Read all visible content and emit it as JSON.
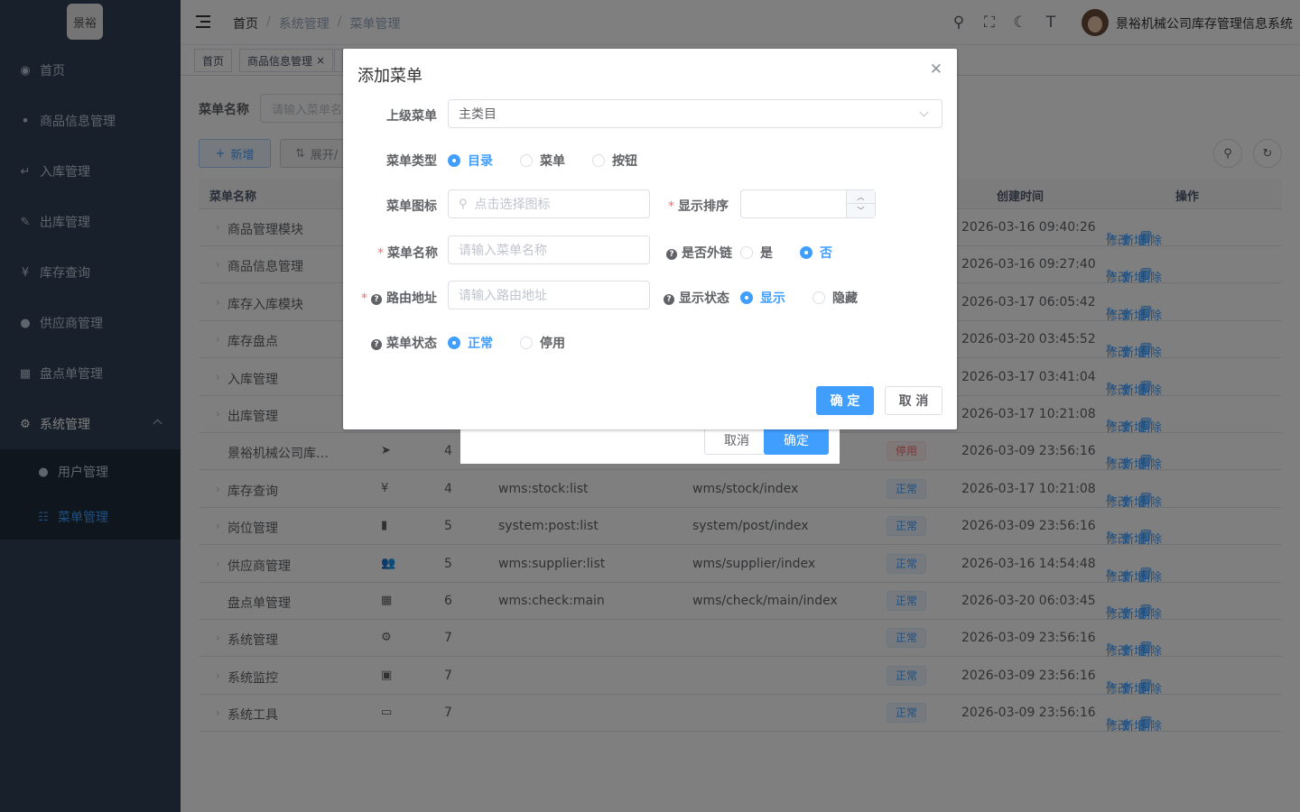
{
  "logo": {
    "text": "景裕"
  },
  "sidebar": {
    "items": [
      {
        "label": "首页",
        "icon": "dashboard-icon"
      },
      {
        "label": "商品信息管理",
        "icon": "tree-icon"
      },
      {
        "label": "入库管理",
        "icon": "enter-icon"
      },
      {
        "label": "出库管理",
        "icon": "edit-doc-icon"
      },
      {
        "label": "库存查询",
        "icon": "yen-icon"
      },
      {
        "label": "供应商管理",
        "icon": "peoples-icon"
      },
      {
        "label": "盘点单管理",
        "icon": "table-icon"
      },
      {
        "label": "系统管理",
        "icon": "gear-icon"
      }
    ],
    "sub_items": [
      {
        "label": "用户管理",
        "icon": "user-icon"
      },
      {
        "label": "菜单管理",
        "icon": "tree-table-icon"
      }
    ]
  },
  "navbar": {
    "breadcrumb": [
      "首页",
      "系统管理",
      "菜单管理"
    ],
    "system_name": "景裕机械公司库存管理信息系统"
  },
  "tags": [
    "首页",
    "商品信息管理"
  ],
  "query": {
    "label": "菜单名称",
    "placeholder": "请输入菜单名"
  },
  "toolbar": {
    "add_label": "新增",
    "expand_label": "展开/"
  },
  "table": {
    "headers": {
      "name": "菜单名称",
      "created": "创建时间",
      "ops": "操作"
    },
    "ops": {
      "edit": "修改",
      "add": "新增",
      "delete": "删除"
    },
    "rows": [
      {
        "name": "商品管理模块",
        "expandable": true,
        "icon": "",
        "sort": "",
        "perm": "",
        "comp": "",
        "status": "",
        "time": "2026-03-16 09:40:26"
      },
      {
        "name": "商品信息管理",
        "expandable": true,
        "icon": "",
        "sort": "",
        "perm": "",
        "comp": "",
        "status": "",
        "time": "2026-03-16 09:27:40"
      },
      {
        "name": "库存入库模块",
        "expandable": true,
        "icon": "",
        "sort": "",
        "perm": "",
        "comp": "",
        "status": "",
        "time": "2026-03-17 06:05:42"
      },
      {
        "name": "库存盘点",
        "expandable": true,
        "icon": "",
        "sort": "",
        "perm": "",
        "comp": "",
        "status": "",
        "time": "2026-03-20 03:45:52"
      },
      {
        "name": "入库管理",
        "expandable": true,
        "icon": "",
        "sort": "",
        "perm": "",
        "comp": "",
        "status": "",
        "time": "2026-03-17 03:41:04"
      },
      {
        "name": "出库管理",
        "expandable": true,
        "icon": "",
        "sort": "",
        "perm": "",
        "comp": "",
        "status": "",
        "time": "2026-03-17 10:21:08"
      },
      {
        "name": "景裕机械公司库…",
        "expandable": false,
        "icon": "➤",
        "sort": "4",
        "perm": "",
        "comp": "",
        "status": "停用",
        "time": "2026-03-09 23:56:16"
      },
      {
        "name": "库存查询",
        "expandable": true,
        "icon": "¥",
        "sort": "4",
        "perm": "wms:stock:list",
        "comp": "wms/stock/index",
        "status": "正常",
        "time": "2026-03-17 10:21:08"
      },
      {
        "name": "岗位管理",
        "expandable": true,
        "icon": "▮",
        "sort": "5",
        "perm": "system:post:list",
        "comp": "system/post/index",
        "status": "正常",
        "time": "2026-03-09 23:56:16"
      },
      {
        "name": "供应商管理",
        "expandable": true,
        "icon": "👥",
        "sort": "5",
        "perm": "wms:supplier:list",
        "comp": "wms/supplier/index",
        "status": "正常",
        "time": "2026-03-16 14:54:48"
      },
      {
        "name": "盘点单管理",
        "expandable": false,
        "icon": "▦",
        "sort": "6",
        "perm": "wms:check:main",
        "comp": "wms/check/main/index",
        "status": "正常",
        "time": "2026-03-20 06:03:45"
      },
      {
        "name": "系统管理",
        "expandable": true,
        "icon": "⚙",
        "sort": "7",
        "perm": "",
        "comp": "",
        "status": "正常",
        "time": "2026-03-09 23:56:16"
      },
      {
        "name": "系统监控",
        "expandable": true,
        "icon": "▣",
        "sort": "7",
        "perm": "",
        "comp": "",
        "status": "正常",
        "time": "2026-03-09 23:56:16"
      },
      {
        "name": "系统工具",
        "expandable": true,
        "icon": "▭",
        "sort": "7",
        "perm": "",
        "comp": "",
        "status": "正常",
        "time": "2026-03-09 23:56:16"
      }
    ]
  },
  "ghost_dialog": {
    "cancel": "取消",
    "confirm": "确定"
  },
  "dialog": {
    "title": "添加菜单",
    "parent": {
      "label": "上级菜单",
      "value": "主类目"
    },
    "type": {
      "label": "菜单类型",
      "options": [
        "目录",
        "菜单",
        "按钮"
      ],
      "selected": "目录"
    },
    "icon_field": {
      "label": "菜单图标",
      "placeholder": "点击选择图标"
    },
    "order": {
      "label": "显示排序",
      "value": ""
    },
    "name": {
      "label": "菜单名称",
      "placeholder": "请输入菜单名称"
    },
    "external": {
      "label": "是否外链",
      "options": [
        "是",
        "否"
      ],
      "selected": "否"
    },
    "path": {
      "label": "路由地址",
      "placeholder": "请输入路由地址"
    },
    "visible": {
      "label": "显示状态",
      "options": [
        "显示",
        "隐藏"
      ],
      "selected": "显示"
    },
    "status": {
      "label": "菜单状态",
      "options": [
        "正常",
        "停用"
      ],
      "selected": "正常"
    },
    "ok": "确 定",
    "cancel": "取 消"
  },
  "colors": {
    "primary": "#409eff",
    "sidebar": "#304156",
    "danger": "#f56c6c"
  }
}
